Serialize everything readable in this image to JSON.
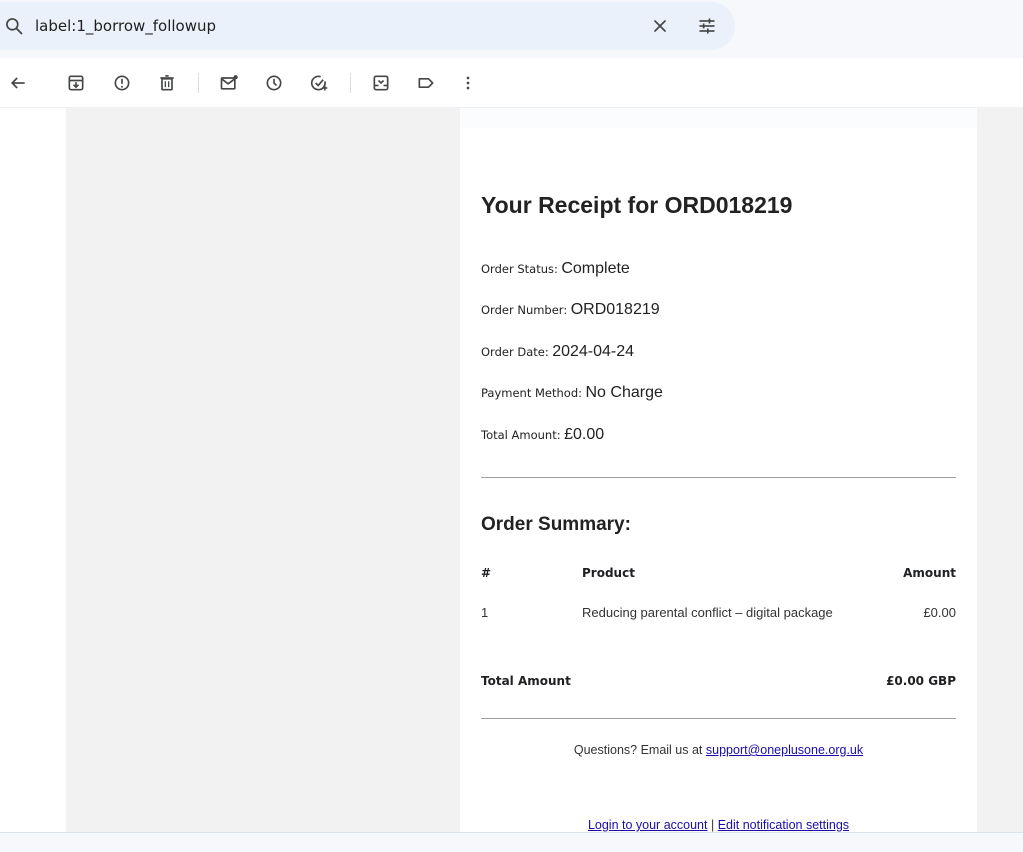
{
  "search": {
    "query": "label:1_borrow_followup"
  },
  "icons": {
    "search": "search-icon",
    "clear": "close-icon",
    "tune": "tune-icon",
    "back": "back-arrow-icon",
    "archive": "archive-icon",
    "spam": "report-spam-icon",
    "delete": "delete-icon",
    "unread": "mark-unread-icon",
    "snooze": "snooze-icon",
    "addtask": "add-task-icon",
    "move": "move-to-icon",
    "label": "label-icon",
    "more": "more-vert-icon"
  },
  "receipt": {
    "title": "Your Receipt for ORD018219",
    "status_label": "Order Status:",
    "status_value": "Complete",
    "number_label": "Order Number:",
    "number_value": "ORD018219",
    "date_label": "Order Date:",
    "date_value": "2024-04-24",
    "payment_label": "Payment Method:",
    "payment_value": "No Charge",
    "total_label": "Total Amount:",
    "total_value": "£0.00",
    "summary_heading": "Order Summary:",
    "table": {
      "headers": [
        "#",
        "Product",
        "Amount"
      ],
      "rows": [
        [
          "1",
          "Reducing parental conflict – digital package",
          "£0.00"
        ]
      ],
      "total_label": "Total Amount",
      "total_value": "£0.00 GBP"
    },
    "questions_text": "Questions? Email us at",
    "support_email": "support@oneplusone.org.uk",
    "login_link": "Login to your account",
    "divider": "|",
    "notification_link": "Edit notification settings"
  },
  "colors": {
    "search_bg": "#eaf1fb",
    "link": "#1a0dab",
    "panel_gray": "#f2f2f2"
  }
}
